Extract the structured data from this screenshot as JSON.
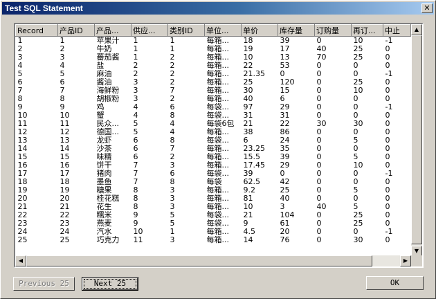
{
  "window": {
    "title": "Test SQL Statement",
    "close_glyph": "✕"
  },
  "grid": {
    "columns": [
      "Record",
      "产品ID",
      "产品...",
      "供应...",
      "类别ID",
      "单位...",
      "单价",
      "库存量",
      "订购量",
      "再订...",
      "中止"
    ],
    "rows": [
      [
        "1",
        "1",
        "苹果汁",
        "1",
        "1",
        "每箱...",
        "18",
        "39",
        "0",
        "10",
        "-1"
      ],
      [
        "2",
        "2",
        "牛奶",
        "1",
        "1",
        "每箱...",
        "19",
        "17",
        "40",
        "25",
        "0"
      ],
      [
        "3",
        "3",
        "蕃茄酱",
        "1",
        "2",
        "每箱...",
        "10",
        "13",
        "70",
        "25",
        "0"
      ],
      [
        "4",
        "4",
        "盐",
        "2",
        "2",
        "每箱...",
        "22",
        "53",
        "0",
        "0",
        "0"
      ],
      [
        "5",
        "5",
        "麻油",
        "2",
        "2",
        "每箱...",
        "21.35",
        "0",
        "0",
        "0",
        "-1"
      ],
      [
        "6",
        "6",
        "酱油",
        "3",
        "2",
        "每箱...",
        "25",
        "120",
        "0",
        "25",
        "0"
      ],
      [
        "7",
        "7",
        "海鲜粉",
        "3",
        "7",
        "每箱...",
        "30",
        "15",
        "0",
        "10",
        "0"
      ],
      [
        "8",
        "8",
        "胡椒粉",
        "3",
        "2",
        "每箱...",
        "40",
        "6",
        "0",
        "0",
        "0"
      ],
      [
        "9",
        "9",
        "鸡",
        "4",
        "6",
        "每袋...",
        "97",
        "29",
        "0",
        "0",
        "-1"
      ],
      [
        "10",
        "10",
        "蟹",
        "4",
        "8",
        "每袋...",
        "31",
        "31",
        "0",
        "0",
        "0"
      ],
      [
        "11",
        "11",
        "民众...",
        "5",
        "4",
        "每袋6包",
        "21",
        "22",
        "30",
        "30",
        "0"
      ],
      [
        "12",
        "12",
        "德国...",
        "5",
        "4",
        "每箱...",
        "38",
        "86",
        "0",
        "0",
        "0"
      ],
      [
        "13",
        "13",
        "龙虾",
        "6",
        "8",
        "每袋...",
        "6",
        "24",
        "0",
        "5",
        "0"
      ],
      [
        "14",
        "14",
        "沙茶",
        "6",
        "7",
        "每箱...",
        "23.25",
        "35",
        "0",
        "0",
        "0"
      ],
      [
        "15",
        "15",
        "味精",
        "6",
        "2",
        "每箱...",
        "15.5",
        "39",
        "0",
        "5",
        "0"
      ],
      [
        "16",
        "16",
        "饼干",
        "7",
        "3",
        "每箱...",
        "17.45",
        "29",
        "0",
        "10",
        "0"
      ],
      [
        "17",
        "17",
        "猪肉",
        "7",
        "6",
        "每袋...",
        "39",
        "0",
        "0",
        "0",
        "-1"
      ],
      [
        "18",
        "18",
        "墨鱼",
        "7",
        "8",
        "每袋",
        "62.5",
        "42",
        "0",
        "0",
        "0"
      ],
      [
        "19",
        "19",
        "糖果",
        "8",
        "3",
        "每箱...",
        "9.2",
        "25",
        "0",
        "5",
        "0"
      ],
      [
        "20",
        "20",
        "桂花糕",
        "8",
        "3",
        "每箱...",
        "81",
        "40",
        "0",
        "0",
        "0"
      ],
      [
        "21",
        "21",
        "花生",
        "8",
        "3",
        "每箱...",
        "10",
        "3",
        "40",
        "5",
        "0"
      ],
      [
        "22",
        "22",
        "糯米",
        "9",
        "5",
        "每袋...",
        "21",
        "104",
        "0",
        "25",
        "0"
      ],
      [
        "23",
        "23",
        "燕麦",
        "9",
        "5",
        "每袋...",
        "9",
        "61",
        "0",
        "25",
        "0"
      ],
      [
        "24",
        "24",
        "汽水",
        "10",
        "1",
        "每箱...",
        "4.5",
        "20",
        "0",
        "0",
        "-1"
      ],
      [
        "25",
        "25",
        "巧克力",
        "11",
        "3",
        "每箱...",
        "14",
        "76",
        "0",
        "30",
        "0"
      ]
    ]
  },
  "buttons": {
    "previous": "Previous 25",
    "next": "Next 25",
    "ok": "OK"
  },
  "scroll_glyphs": {
    "up": "▲",
    "down": "▼",
    "left": "◀",
    "right": "▶"
  }
}
